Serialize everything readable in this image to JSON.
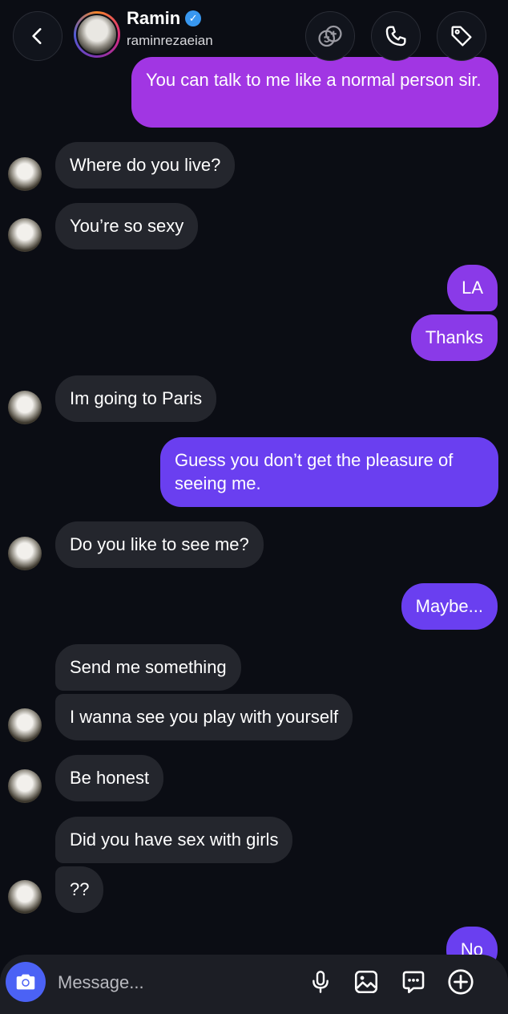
{
  "header": {
    "name": "Ramin",
    "username": "raminrezaeian",
    "verified_mark": "✓"
  },
  "messages": [
    {
      "dir": "out",
      "text": "You can talk to me like a normal person sir."
    },
    {
      "dir": "in",
      "text": "Where do you live?"
    },
    {
      "dir": "in",
      "text": "You’re so sexy"
    },
    {
      "dir": "out",
      "text": "LA"
    },
    {
      "dir": "out",
      "text": "Thanks"
    },
    {
      "dir": "in",
      "text": "Im going to Paris"
    },
    {
      "dir": "out",
      "text": "Guess you don’t get the pleasure of seeing me."
    },
    {
      "dir": "in",
      "text": "Do you like to see me?"
    },
    {
      "dir": "out",
      "text": "Maybe..."
    },
    {
      "dir": "in",
      "text": "Send me something"
    },
    {
      "dir": "in",
      "text": "I wanna see you play with yourself"
    },
    {
      "dir": "in",
      "text": "Be honest"
    },
    {
      "dir": "in",
      "text": "Did you have sex with girls"
    },
    {
      "dir": "in",
      "text": "??"
    },
    {
      "dir": "out",
      "text": "No"
    }
  ],
  "composer": {
    "placeholder": "Message..."
  },
  "icons": {
    "back": "chevron-left-icon",
    "game": "game-controller-icon",
    "call": "phone-icon",
    "tag": "tag-icon",
    "camera": "camera-icon",
    "mic": "microphone-icon",
    "gallery": "image-icon",
    "sticker": "chat-bubble-icon",
    "add": "plus-circle-icon"
  },
  "colors": {
    "background": "#0b0d14",
    "incoming_bubble": "#24262d",
    "outgoing_pink": "#a136e3",
    "outgoing_purple": "#8a3ae8",
    "outgoing_violet": "#6a3ff0",
    "camera_button": "#4b62f5",
    "verified": "#3897f0"
  }
}
